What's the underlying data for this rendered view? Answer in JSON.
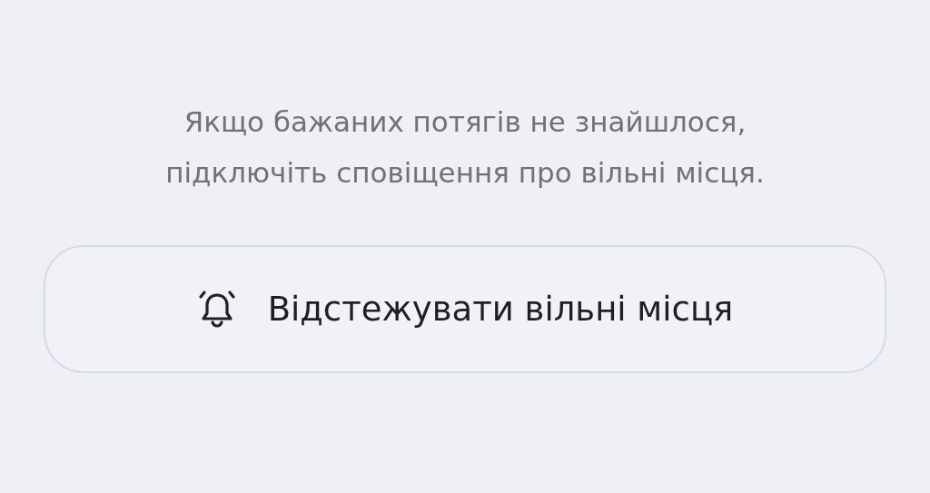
{
  "message": "Якщо бажаних потягів не знайшлося, підключіть сповіщення про вільні місця.",
  "button": {
    "label": "Відстежувати вільні місця"
  }
}
